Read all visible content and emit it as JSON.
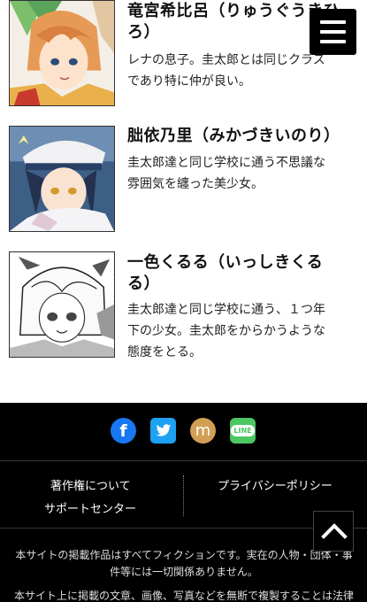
{
  "characters": [
    {
      "name": "竜宮希比呂（りゅうぐうきひろ）",
      "name_line1": "竜宮希比呂（りゅうぐうきひ",
      "name_line2": "ろ）",
      "desc_line1": "レナの息子。圭太郎とは同じクラス",
      "desc_line2": "であり特に仲が良い。"
    },
    {
      "name": "朏依乃里（みかづきいのり）",
      "desc_line1": "圭太郎達と同じ学校に通う不思議な",
      "desc_line2": "雰囲気を纏った美少女。"
    },
    {
      "name_line1": "一色くるる（いっしきくる",
      "name_line2": "る）",
      "desc_line1": "圭太郎達と同じ学校に通う、１つ年",
      "desc_line2": "下の少女。圭太郎をからかうような",
      "desc_line3": "態度をとる。"
    }
  ],
  "social": {
    "facebook_icon": "facebook-icon",
    "twitter_icon": "twitter-icon",
    "mixi_icon": "mixi-icon",
    "line_icon": "line-icon",
    "line_label": "LINE",
    "mixi_label": "m"
  },
  "footer": {
    "copyright": "著作権について",
    "privacy": "プライバシーポリシー",
    "support": "サポートセンター",
    "disclaimer_line1": "本サイトの掲載作品はすべてフィクションです。実在の人物・団体・事",
    "disclaimer_line2": "件等には一切関係ありません。",
    "notice_partial": "本サイト上に掲載の文章、画像、写真などを無断で複製することは法律"
  },
  "colors": {
    "facebook": "#1877f2",
    "twitter": "#1da1f2",
    "mixi": "#d1a055",
    "line": "#4cc764"
  }
}
